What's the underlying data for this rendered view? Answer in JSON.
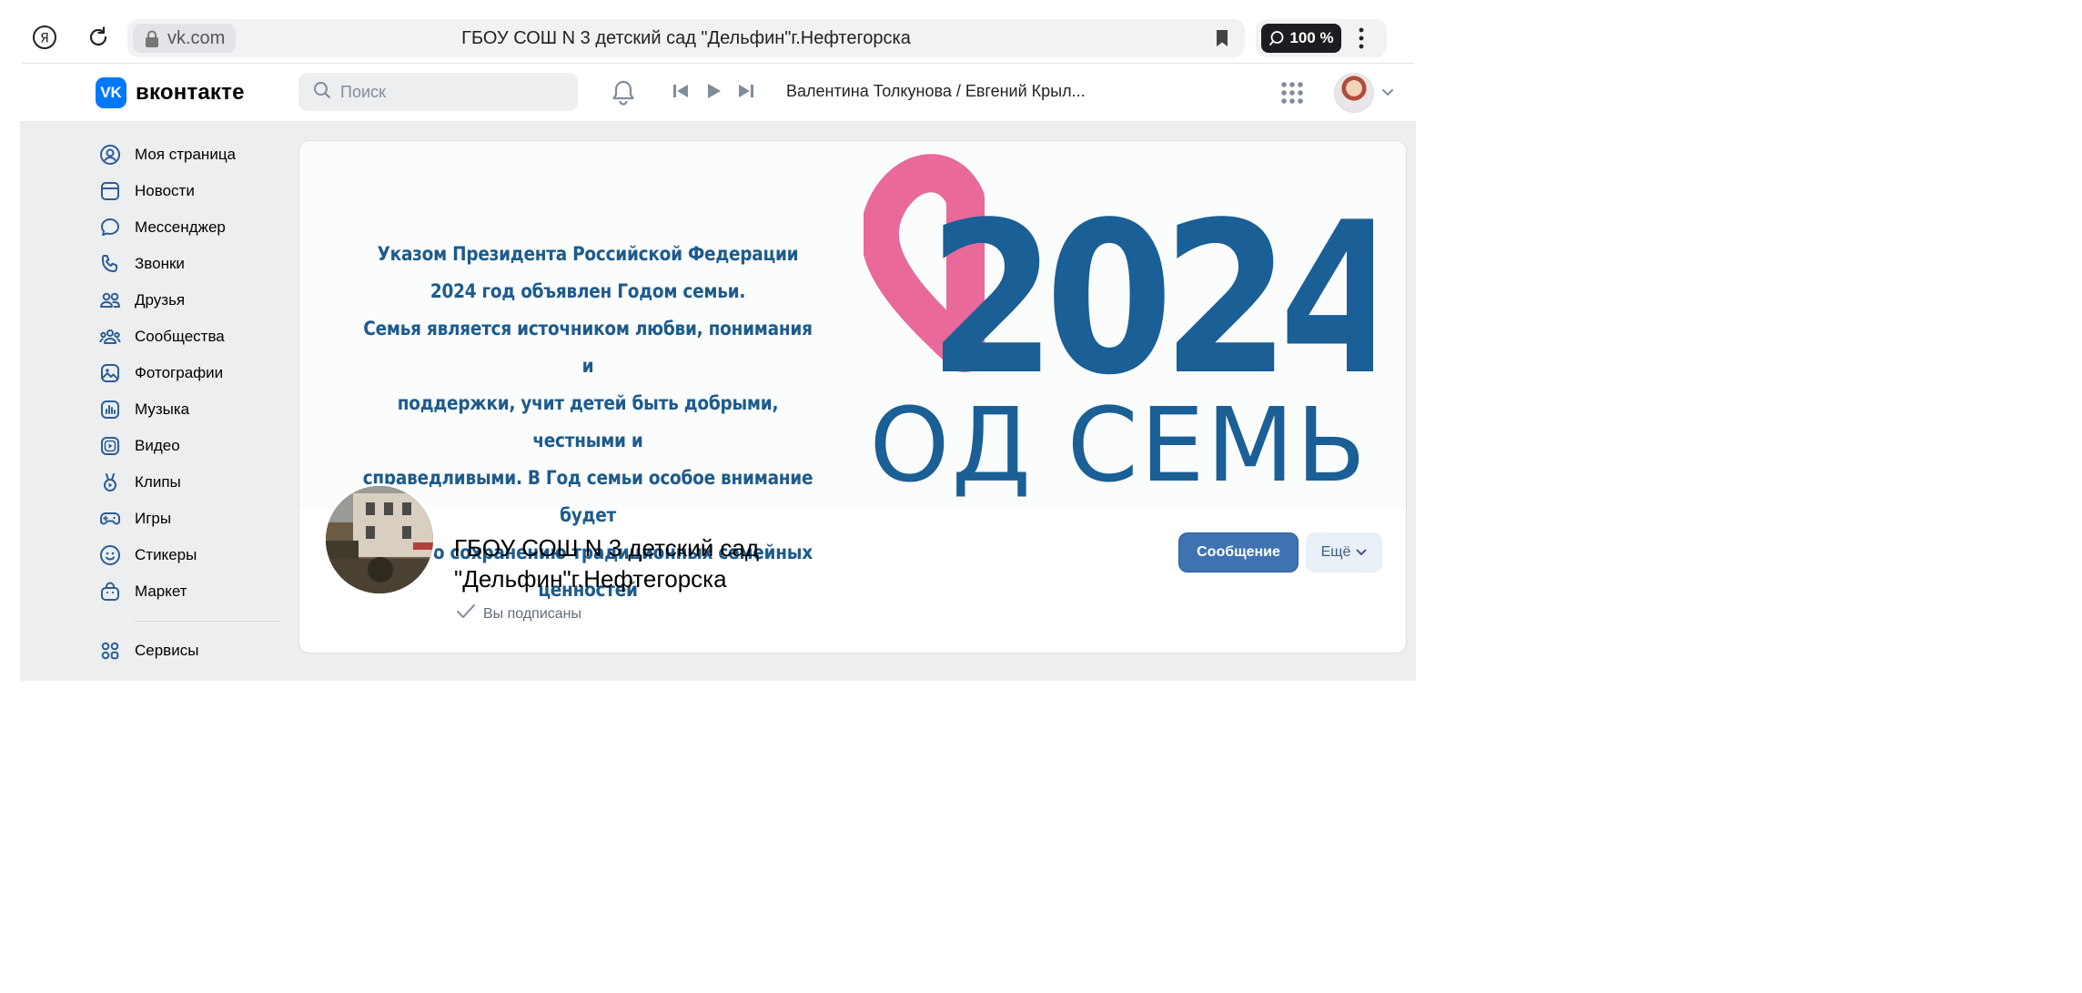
{
  "browser": {
    "domain": "vk.com",
    "title": "ГБОУ СОШ N 3 детский сад \"Дельфин\"г.Нефтегорска",
    "zoom": "100 %"
  },
  "header": {
    "logo_text": "вконтакте",
    "search_placeholder": "Поиск",
    "now_playing": "Валентина Толкунова / Евгений Крыл..."
  },
  "sidebar": {
    "items": [
      {
        "label": "Моя страница",
        "icon": "user-circle-icon"
      },
      {
        "label": "Новости",
        "icon": "news-icon"
      },
      {
        "label": "Мессенджер",
        "icon": "message-bubble-icon"
      },
      {
        "label": "Звонки",
        "icon": "phone-icon"
      },
      {
        "label": "Друзья",
        "icon": "friends-icon"
      },
      {
        "label": "Сообщества",
        "icon": "communities-icon"
      },
      {
        "label": "Фотографии",
        "icon": "photo-icon"
      },
      {
        "label": "Музыка",
        "icon": "music-icon"
      },
      {
        "label": "Видео",
        "icon": "video-icon"
      },
      {
        "label": "Клипы",
        "icon": "clips-icon"
      },
      {
        "label": "Игры",
        "icon": "gamepad-icon"
      },
      {
        "label": "Стикеры",
        "icon": "smile-icon"
      },
      {
        "label": "Маркет",
        "icon": "bag-icon"
      }
    ],
    "services_label": "Сервисы"
  },
  "cover": {
    "text_lines": [
      "Указом Президента Российской Федерации",
      "2024 год объявлен Годом семьи.",
      "Семья является источником любви, понимания и",
      "поддержки, учит детей быть добрыми, честными и",
      "справедливыми. В Год семьи особое внимание будет",
      "уделено сохранению традиционных семейных ценностей"
    ],
    "year": "2024",
    "slogan": "ГОД СЕМЬИ",
    "colors": {
      "heart": "#e8699a",
      "blue": "#1a5f95"
    }
  },
  "group": {
    "name": "ГБОУ СОШ N 3 детский сад \"Дельфин\"г.Нефтегорска",
    "subscribed": "Вы подписаны",
    "message_button": "Сообщение",
    "more_button": "Ещё"
  }
}
